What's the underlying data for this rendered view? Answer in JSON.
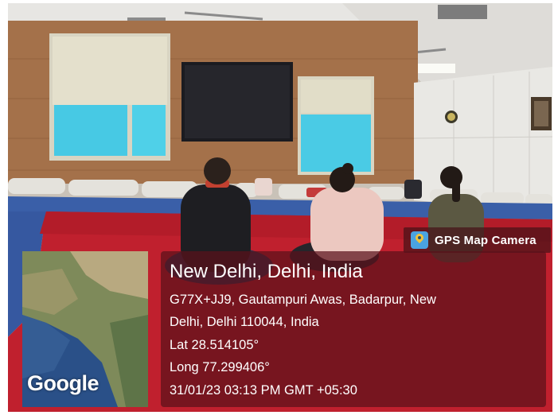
{
  "overlay": {
    "app_name": "GPS Map Camera",
    "location_title": "New Delhi, Delhi, India",
    "address_line1": "G77X+JJ9, Gautampuri Awas, Badarpur, New",
    "address_line2": "Delhi, Delhi 110044, India",
    "latitude": "Lat 28.514105°",
    "longitude": "Long 77.299406°",
    "datetime": "31/01/23 03:13 PM GMT +05:30",
    "map_brand": "Google"
  },
  "colors": {
    "panel_bg": "#5a101a",
    "carpet": "#c0202e",
    "mat": "#3a5fa8",
    "wall_panel": "#9a6a45"
  }
}
